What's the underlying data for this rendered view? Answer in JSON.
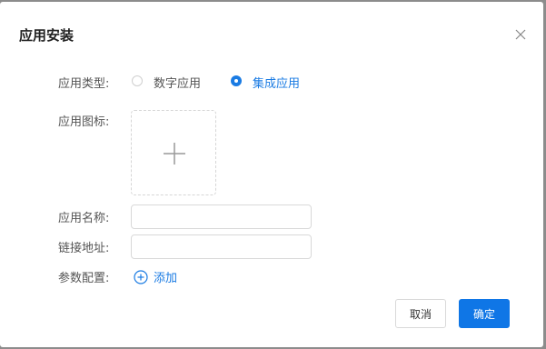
{
  "dialog": {
    "title": "应用安装",
    "type_label": "应用类型:",
    "type_options": [
      {
        "label": "数字应用",
        "checked": false
      },
      {
        "label": "集成应用",
        "checked": true
      }
    ],
    "icon_label": "应用图标:",
    "name_label": "应用名称:",
    "name_value": "",
    "url_label": "链接地址:",
    "url_value": "",
    "params_label": "参数配置:",
    "add_label": "添加",
    "cancel_label": "取消",
    "ok_label": "确定"
  },
  "colors": {
    "accent": "#1a7be3",
    "overlay": "#8c8c8c"
  }
}
